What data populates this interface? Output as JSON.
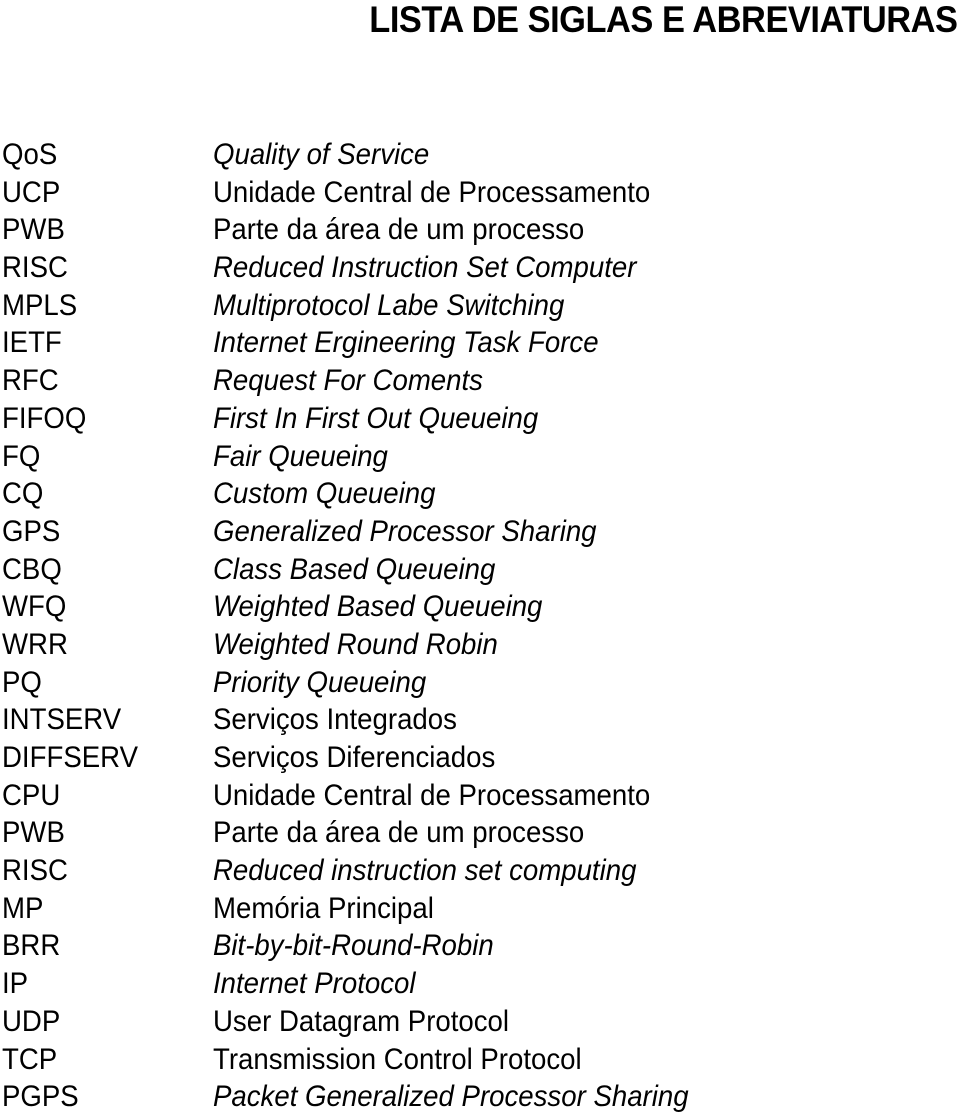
{
  "page": {
    "title": "LISTA DE SIGLAS E ABREVIATURAS"
  },
  "glossary": {
    "entries": [
      {
        "abbr": "QoS",
        "definition": "Quality of Service",
        "italic": true
      },
      {
        "abbr": "UCP",
        "definition": "Unidade Central de Processamento",
        "italic": false
      },
      {
        "abbr": "PWB",
        "definition": "Parte da área de um processo",
        "italic": false
      },
      {
        "abbr": "RISC",
        "definition": "Reduced Instruction Set Computer",
        "italic": true
      },
      {
        "abbr": "MPLS",
        "definition": "Multiprotocol Labe Switching",
        "italic": true
      },
      {
        "abbr": "IETF",
        "definition": "Internet Ergineering Task Force",
        "italic": true
      },
      {
        "abbr": "RFC",
        "definition": "Request For Coments",
        "italic": true
      },
      {
        "abbr": "FIFOQ",
        "definition": "First In First Out Queueing",
        "italic": true
      },
      {
        "abbr": "FQ",
        "definition": "Fair Queueing",
        "italic": true
      },
      {
        "abbr": "CQ",
        "definition": "Custom Queueing",
        "italic": true
      },
      {
        "abbr": "GPS",
        "definition": "Generalized Processor Sharing",
        "italic": true
      },
      {
        "abbr": "CBQ",
        "definition": "Class Based Queueing",
        "italic": true
      },
      {
        "abbr": "WFQ",
        "definition": "Weighted Based Queueing",
        "italic": true
      },
      {
        "abbr": "WRR",
        "definition": "Weighted Round Robin",
        "italic": true
      },
      {
        "abbr": "PQ",
        "definition": "Priority Queueing",
        "italic": true
      },
      {
        "abbr": "INTSERV",
        "definition": "Serviços Integrados",
        "italic": false
      },
      {
        "abbr": "DIFFSERV",
        "definition": "Serviços Diferenciados",
        "italic": false
      },
      {
        "abbr": "CPU",
        "definition": "Unidade Central de Processamento",
        "italic": false
      },
      {
        "abbr": "PWB",
        "definition": "Parte da área de um processo",
        "italic": false
      },
      {
        "abbr": "RISC",
        "definition": "Reduced instruction set computing",
        "italic": true
      },
      {
        "abbr": "MP",
        "definition": "Memória Principal",
        "italic": false
      },
      {
        "abbr": "BRR",
        "definition": "Bit-by-bit-Round-Robin",
        "italic": true
      },
      {
        "abbr": "IP",
        "definition": "Internet Protocol",
        "italic": true
      },
      {
        "abbr": "UDP",
        "definition": "User Datagram Protocol",
        "italic": false
      },
      {
        "abbr": "TCP",
        "definition": "Transmission Control Protocol",
        "italic": false
      },
      {
        "abbr": "PGPS",
        "definition": "Packet Generalized Processor Sharing",
        "italic": true
      }
    ]
  }
}
